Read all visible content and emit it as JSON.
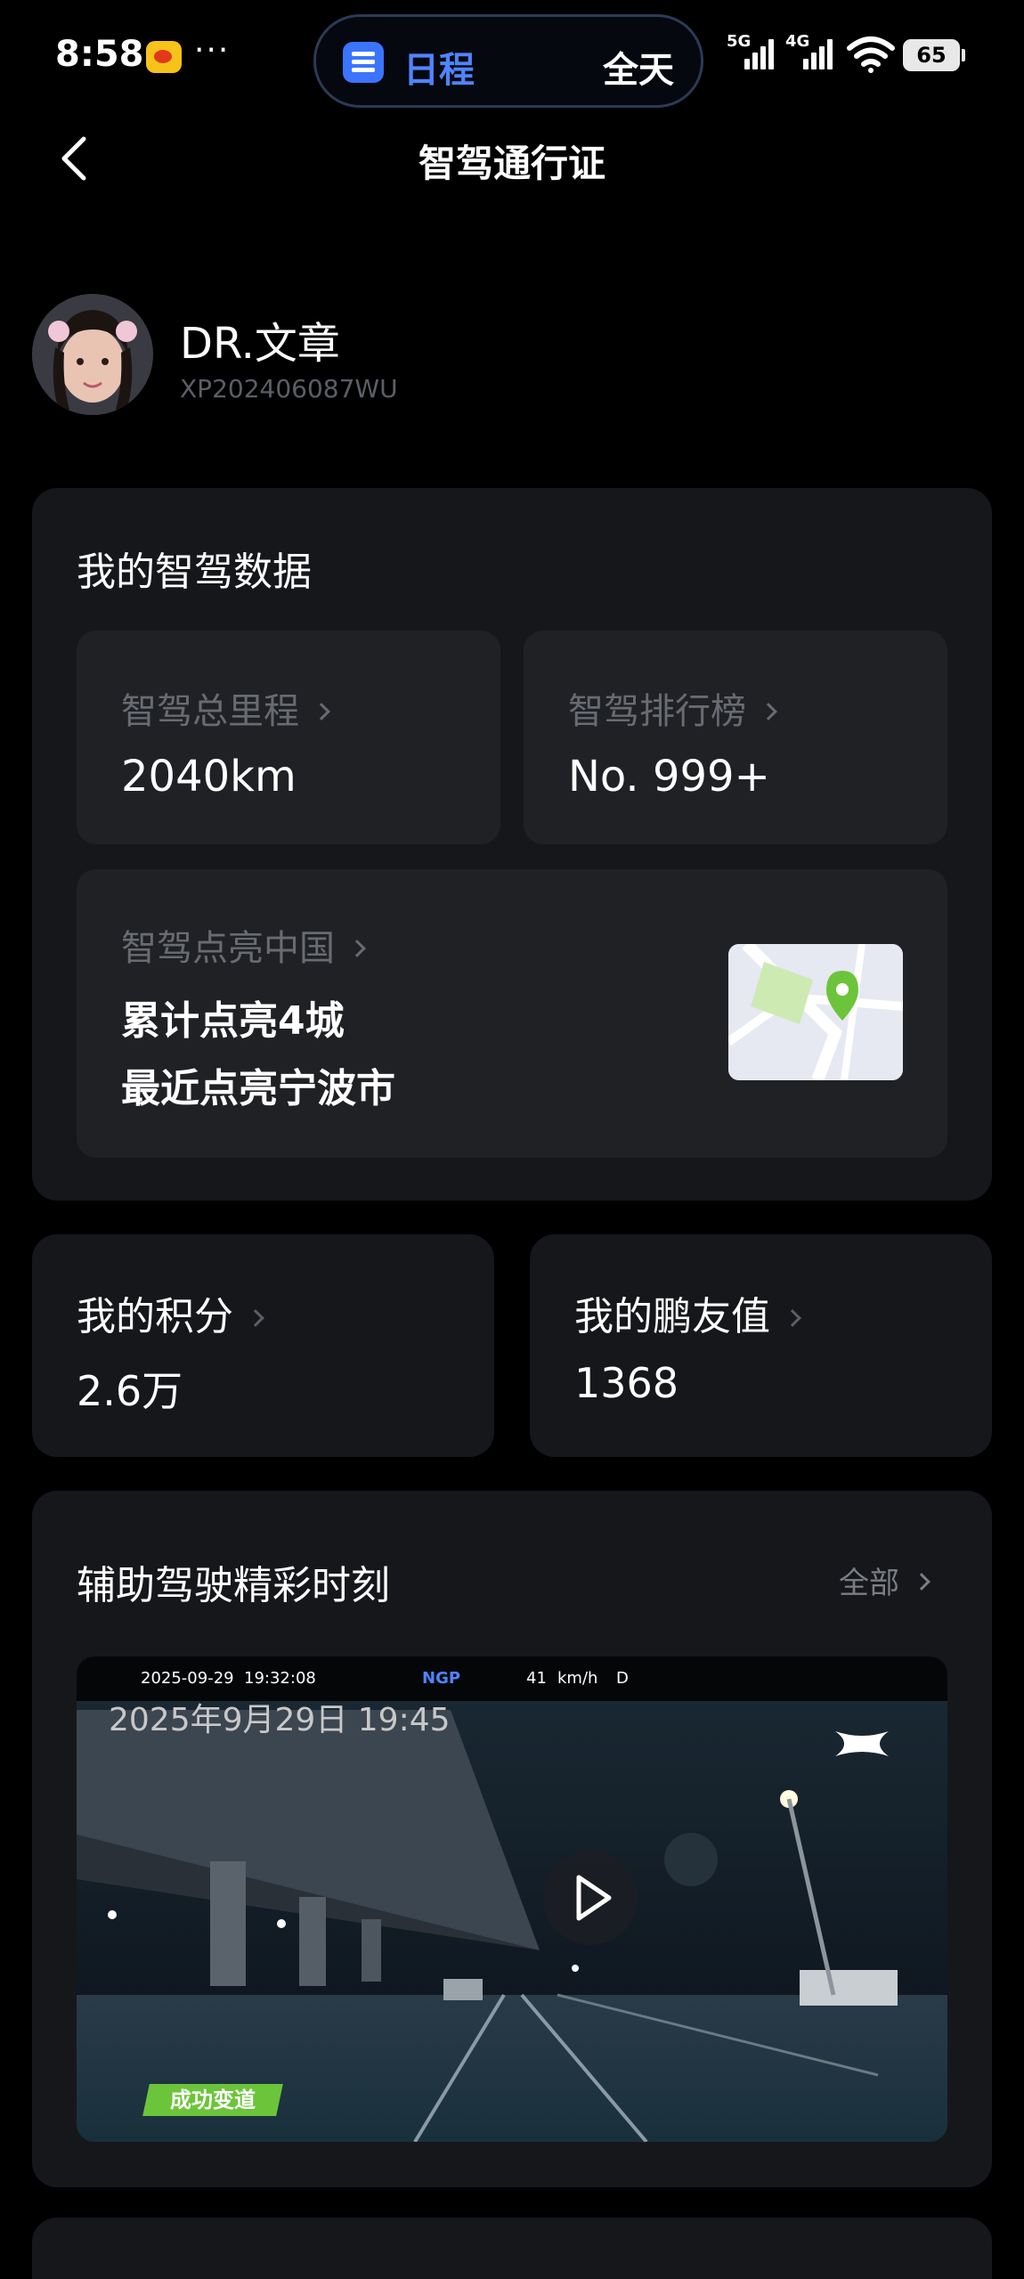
{
  "status_bar": {
    "time": "8:58",
    "more": "···",
    "pill_label": "日程",
    "pill_right": "全天",
    "net1": "5G",
    "net2": "4G",
    "battery": "65"
  },
  "nav": {
    "title": "智驾通行证",
    "back_icon": "chevron-left-icon"
  },
  "profile": {
    "name": "DR.文章",
    "id": "XP202406087WU"
  },
  "smart_drive": {
    "title": "我的智驾数据",
    "total_mileage_label": "智驾总里程",
    "total_mileage_value": "2040km",
    "ranking_label": "智驾排行榜",
    "ranking_value": "No. 999+",
    "light_china_label": "智驾点亮中国",
    "light_line1": "累计点亮4城",
    "light_line2": "最近点亮宁波市"
  },
  "points": {
    "label": "我的积分",
    "value": "2.6万"
  },
  "friend_value": {
    "label": "我的鹏友值",
    "value": "1368"
  },
  "highlights": {
    "title": "辅助驾驶精彩时刻",
    "see_all": "全部",
    "video": {
      "osd_date": "2025-09-29",
      "osd_time": "19:32:08",
      "osd_ngp": "NGP",
      "osd_speed": "41",
      "osd_unit": "km/h",
      "osd_gear": "D",
      "overlay_date": "2025年9月29日 19:45",
      "tag": "成功变道"
    }
  },
  "colors": {
    "background": "#000000",
    "card": "#16171b",
    "tile": "#202125",
    "accent_blue": "#4f84ff",
    "map_pin": "#6cc43a"
  }
}
